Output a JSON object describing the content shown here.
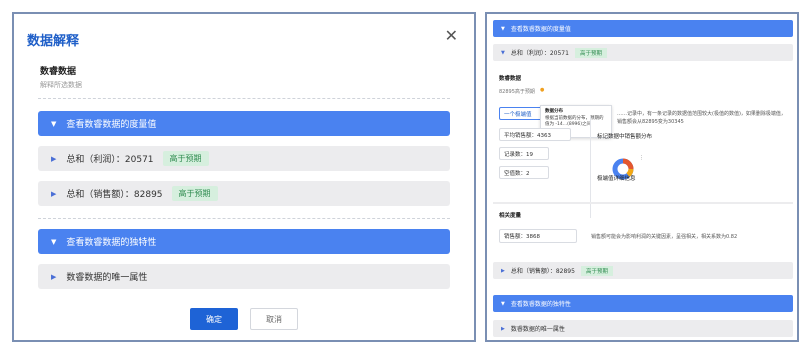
{
  "dialog": {
    "title": "数据解释",
    "close_icon": "close-icon",
    "section_title": "数睿数据",
    "section_subtitle": "解释所选数据",
    "blocks": [
      {
        "label": "查看数睿数据的度量值",
        "expanded": true
      },
      {
        "label": "总和（利润）：20571",
        "badge": "高于预期",
        "expanded": false
      },
      {
        "label": "总和（销售额）：82895",
        "badge": "高于预期",
        "expanded": false
      },
      {
        "label": "查看数睿数据的独特性",
        "expanded": true
      },
      {
        "label": "数睿数据的唯一属性",
        "expanded": false
      }
    ],
    "ok_label": "确定",
    "cancel_label": "取消"
  },
  "panel": {
    "top_bar": "查看数睿数据的度量值",
    "profit_row": {
      "label": "总和（利润）：20571",
      "badge": "高于预期"
    },
    "section_title": "数睿数据",
    "section_sub": "82895高于预期",
    "tooltip": {
      "title": "数据分布",
      "body": "根据当前数据的分布，预期的值为 -14...(8996)之间"
    },
    "selected_button": "一个极端值",
    "description": "……记录中，有一条记录的数据值范围较大(极值的数值)，如果删除极端值，销售额会从82895变为30345",
    "stats": [
      {
        "label": "平均销售额：4363"
      },
      {
        "label": "记录数：19"
      },
      {
        "label": "空值数：2"
      }
    ],
    "chart_title": "标记数据中销售额分布",
    "details_title": "极端值详细信息",
    "related_title": "相关度量",
    "related_box": "销售额：3868",
    "related_text": "销售额可能会为影响利润的关键因素，呈强相关，相关系数为0.82",
    "sales_row": {
      "label": "总和（销售额）：82895",
      "badge": "高于预期"
    },
    "unique_bar": "查看数睿数据的独特性",
    "unique_row": "数睿数据的唯一属性"
  },
  "colors": {
    "primary": "#4a82f0",
    "title_blue": "#1f5fc8",
    "badge_bg": "#d6efde",
    "badge_text": "#2e8b4f"
  }
}
